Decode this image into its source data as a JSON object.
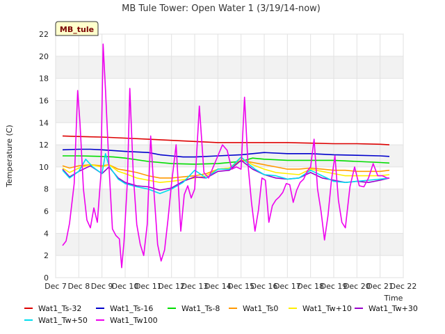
{
  "chart_data": {
    "type": "line",
    "title": "MB Tule Tower: Open Water 1 (3/19/14-now)",
    "xlabel": "Time",
    "ylabel": "Temperature (C)",
    "badge": "MB_tule",
    "xlim": [
      7,
      22
    ],
    "ylim": [
      0,
      22
    ],
    "x_ticks": [
      7,
      8,
      9,
      10,
      11,
      12,
      13,
      14,
      15,
      16,
      17,
      18,
      19,
      20,
      21,
      22
    ],
    "x_tick_labels": [
      "Dec 7",
      "Dec 8",
      "Dec 9",
      "Dec 10",
      "Dec 11",
      "Dec 12",
      "Dec 13",
      "Dec 14",
      "Dec 15",
      "Dec 16",
      "Dec 17",
      "Dec 18",
      "Dec 19",
      "Dec 20",
      "Dec 21",
      "Dec 22"
    ],
    "y_ticks": [
      0,
      2,
      4,
      6,
      8,
      10,
      12,
      14,
      16,
      18,
      20,
      22
    ],
    "grid": true,
    "legend_position": "bottom",
    "series": [
      {
        "name": "Wat1_Ts-32",
        "color": "#dd0000",
        "x": [
          7.3,
          8,
          9,
          10,
          11,
          12,
          13,
          14,
          15,
          16,
          17,
          18,
          19,
          20,
          21,
          21.4
        ],
        "y": [
          12.8,
          12.75,
          12.7,
          12.6,
          12.5,
          12.4,
          12.3,
          12.2,
          12.2,
          12.2,
          12.2,
          12.15,
          12.1,
          12.1,
          12.05,
          12.0
        ]
      },
      {
        "name": "Wat1_Ts-16",
        "color": "#0000cc",
        "x": [
          7.3,
          8,
          8.5,
          9,
          10,
          11,
          11.5,
          12,
          12.5,
          13,
          14,
          15,
          15.5,
          16,
          17,
          18,
          19,
          20,
          21,
          21.4
        ],
        "y": [
          11.55,
          11.6,
          11.6,
          11.55,
          11.4,
          11.3,
          11.1,
          11.0,
          10.9,
          10.9,
          11.0,
          11.1,
          11.2,
          11.3,
          11.2,
          11.2,
          11.1,
          11.05,
          11.0,
          10.95
        ]
      },
      {
        "name": "Wat1_Ts-8",
        "color": "#00dd00",
        "x": [
          7.3,
          8,
          9,
          9.5,
          10,
          11,
          12,
          13,
          14,
          15,
          15.5,
          16,
          17,
          18,
          19,
          20,
          21,
          21.4
        ],
        "y": [
          11.0,
          11.0,
          10.95,
          10.9,
          10.8,
          10.5,
          10.3,
          10.25,
          10.3,
          10.5,
          10.8,
          10.7,
          10.6,
          10.6,
          10.6,
          10.5,
          10.4,
          10.35
        ]
      },
      {
        "name": "Wat1_Ts0",
        "color": "#ff9900",
        "x": [
          7.3,
          7.6,
          8,
          8.5,
          9,
          9.3,
          9.7,
          10,
          10.5,
          11,
          11.5,
          12,
          13,
          13.5,
          14,
          14.5,
          15,
          15.5,
          16,
          16.5,
          17,
          17.5,
          18,
          18.5,
          19,
          19.5,
          20,
          20.5,
          21,
          21.4
        ],
        "y": [
          10.1,
          9.9,
          10.1,
          10.2,
          10.1,
          10.2,
          9.8,
          9.7,
          9.5,
          9.2,
          9.0,
          9.0,
          9.2,
          9.4,
          9.8,
          9.9,
          10.6,
          10.4,
          10.2,
          10.0,
          9.8,
          9.8,
          9.9,
          9.8,
          9.7,
          9.7,
          9.6,
          9.6,
          9.6,
          9.7
        ]
      },
      {
        "name": "Wat1_Tw+10",
        "color": "#ffee00",
        "x": [
          7.3,
          7.6,
          8,
          8.5,
          9,
          9.3,
          9.7,
          10,
          10.5,
          11,
          11.5,
          12,
          13,
          13.5,
          14,
          14.5,
          15,
          15.5,
          16,
          16.5,
          17,
          17.5,
          18,
          18.5,
          19,
          19.5,
          20,
          20.5,
          21,
          21.4
        ],
        "y": [
          9.9,
          9.5,
          9.9,
          10.2,
          10.0,
          10.2,
          9.6,
          9.4,
          9.0,
          8.8,
          8.6,
          8.7,
          9.0,
          9.2,
          9.8,
          9.9,
          10.8,
          10.2,
          9.8,
          9.5,
          9.4,
          9.3,
          9.8,
          9.6,
          9.4,
          9.2,
          9.2,
          9.2,
          9.2,
          9.3
        ]
      },
      {
        "name": "Wat1_Tw+30",
        "color": "#9900cc",
        "x": [
          7.3,
          7.6,
          8,
          8.5,
          9,
          9.3,
          9.7,
          10,
          10.5,
          11,
          11.5,
          12,
          12.5,
          13,
          13.5,
          14,
          14.5,
          15,
          15.5,
          16,
          16.5,
          17,
          17.5,
          18,
          18.5,
          19,
          19.5,
          20,
          20.5,
          21,
          21.4
        ],
        "y": [
          9.8,
          9.1,
          9.6,
          10.1,
          9.4,
          10.0,
          9.0,
          8.6,
          8.3,
          8.2,
          7.9,
          8.1,
          8.7,
          9.1,
          9.0,
          9.6,
          9.7,
          10.6,
          9.8,
          9.3,
          9.0,
          8.9,
          9.0,
          9.5,
          9.0,
          8.8,
          8.6,
          8.7,
          8.6,
          8.8,
          9.0
        ]
      },
      {
        "name": "Wat1_Tw+50",
        "color": "#00ddee",
        "x": [
          7.3,
          7.6,
          8,
          8.3,
          8.6,
          9,
          9.15,
          9.3,
          9.7,
          10,
          10.5,
          11,
          11.5,
          12,
          12.5,
          13,
          13.5,
          14,
          14.5,
          15,
          15.3,
          15.6,
          16,
          16.5,
          17,
          17.5,
          18,
          18.5,
          19,
          19.5,
          20,
          20.5,
          21,
          21.4
        ],
        "y": [
          9.7,
          9.0,
          9.6,
          10.7,
          10.0,
          9.4,
          11.2,
          10.1,
          8.9,
          8.5,
          8.2,
          8.0,
          7.6,
          8.0,
          8.6,
          9.7,
          9.0,
          9.8,
          9.8,
          10.9,
          10.3,
          9.8,
          9.3,
          9.2,
          8.9,
          9.0,
          9.7,
          9.2,
          8.7,
          8.6,
          8.7,
          8.8,
          8.9,
          9.0
        ]
      },
      {
        "name": "Wat1_Tw100",
        "color": "#ee00ee",
        "x": [
          7.3,
          7.45,
          7.6,
          7.8,
          7.95,
          8.05,
          8.2,
          8.35,
          8.5,
          8.65,
          8.8,
          8.95,
          9.05,
          9.15,
          9.3,
          9.45,
          9.6,
          9.75,
          9.85,
          9.95,
          10.1,
          10.2,
          10.35,
          10.5,
          10.65,
          10.8,
          10.95,
          11.1,
          11.25,
          11.4,
          11.55,
          11.7,
          11.85,
          12.0,
          12.2,
          12.4,
          12.55,
          12.7,
          12.85,
          13.0,
          13.2,
          13.4,
          13.6,
          13.8,
          14.0,
          14.2,
          14.4,
          14.6,
          14.8,
          15.0,
          15.15,
          15.3,
          15.45,
          15.6,
          15.75,
          15.9,
          16.05,
          16.2,
          16.35,
          16.5,
          16.65,
          16.8,
          16.95,
          17.1,
          17.25,
          17.4,
          17.55,
          17.7,
          17.85,
          18.0,
          18.15,
          18.3,
          18.45,
          18.6,
          18.75,
          18.9,
          19.05,
          19.2,
          19.35,
          19.5,
          19.7,
          19.9,
          20.1,
          20.3,
          20.5,
          20.7,
          20.9,
          21.1,
          21.3,
          21.4
        ],
        "y": [
          2.9,
          3.3,
          4.9,
          8.5,
          16.9,
          14.0,
          8.0,
          5.2,
          4.5,
          6.3,
          5.0,
          9.2,
          21.1,
          17.0,
          10.1,
          4.4,
          3.8,
          3.5,
          0.9,
          3.2,
          8.8,
          17.1,
          9.3,
          4.8,
          3.0,
          2.0,
          4.8,
          12.8,
          7.5,
          3.0,
          1.5,
          2.5,
          5.3,
          8.5,
          12.0,
          4.2,
          7.5,
          8.3,
          7.2,
          8.0,
          15.5,
          9.5,
          9.0,
          10.0,
          11.0,
          12.0,
          11.5,
          9.8,
          10.0,
          9.8,
          16.3,
          10.2,
          6.8,
          4.2,
          6.1,
          9.0,
          8.8,
          5.0,
          6.5,
          7.0,
          7.3,
          7.7,
          8.5,
          8.4,
          6.8,
          7.9,
          8.6,
          8.9,
          9.6,
          10.0,
          12.5,
          8.0,
          6.0,
          3.4,
          5.6,
          8.8,
          11.0,
          7.0,
          5.0,
          4.5,
          8.2,
          10.0,
          8.3,
          8.2,
          9.0,
          10.3,
          9.2,
          9.2,
          9.0,
          9.0
        ]
      }
    ]
  }
}
